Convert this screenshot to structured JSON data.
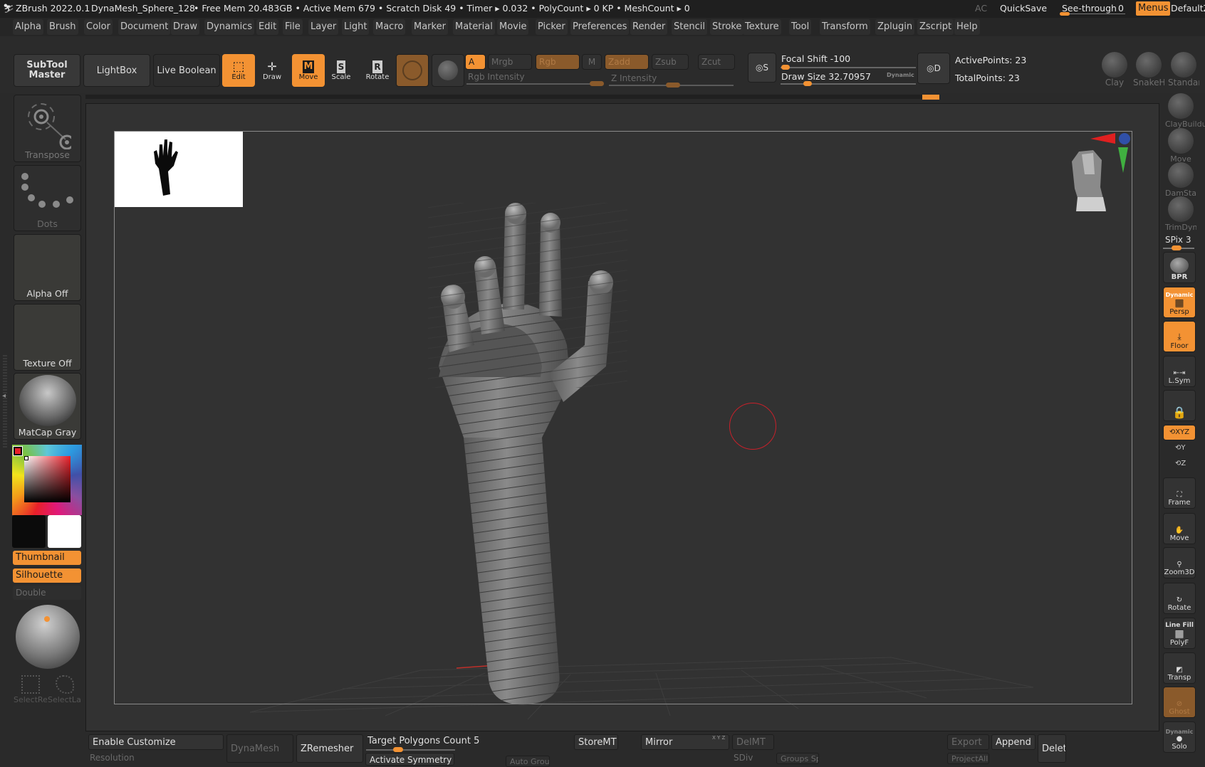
{
  "titlebar": {
    "app": "ZBrush 2022.0.1",
    "document": "DynaMesh_Sphere_128",
    "stats": "• Free Mem 20.483GB • Active Mem 679 • Scratch Disk 49 •  Timer ▸ 0.032 • PolyCount ▸ 0 KP  • MeshCount ▸ 0",
    "ac": "AC",
    "quicksave": "QuickSave",
    "see_through_label": "See-through",
    "see_through_value": "0",
    "menus": "Menus",
    "default_script": "DefaultZScript"
  },
  "menubar": [
    "Alpha",
    "Brush",
    "Color",
    "Document",
    "Draw",
    "Dynamics",
    "Edit",
    "File",
    "Layer",
    "Light",
    "Macro",
    "Marker",
    "Material",
    "Movie",
    "Picker",
    "Preferences",
    "Render",
    "Stencil",
    "Stroke",
    "Texture",
    "Tool",
    "Transform",
    "Zplugin",
    "Zscript",
    "Help"
  ],
  "shelf": {
    "subtool_master": "SubTool Master",
    "lightbox": "LightBox",
    "live_boolean": "Live Boolean",
    "edit": "Edit",
    "draw": "Draw",
    "move": "Move",
    "scale": "Scale",
    "rotate": "Rotate",
    "a": "A",
    "mrgb": "Mrgb",
    "rgb": "Rgb",
    "m": "M",
    "zadd": "Zadd",
    "zsub": "Zsub",
    "zcut": "Zcut",
    "rgb_intensity": "Rgb Intensity",
    "z_intensity": "Z Intensity",
    "focal_shift": "Focal Shift -100",
    "draw_size": "Draw Size 32.70957",
    "dynamic": "Dynamic",
    "active_points": "ActivePoints: 23",
    "total_points": "TotalPoints: 23",
    "s_label": "S",
    "d_label": "D"
  },
  "brushes": [
    "Clay",
    "SnakeHook",
    "Standard",
    "ClayBuildup",
    "Move",
    "DamStandard",
    "TrimDynamic"
  ],
  "leftbar": {
    "transpose": "Transpose",
    "dots": "Dots",
    "alpha": "Alpha Off",
    "texture": "Texture Off",
    "material": "MatCap Gray",
    "thumbnail": "Thumbnail",
    "silhouette": "Silhouette",
    "double": "Double",
    "select_rect": "SelectRect",
    "select_lasso": "SelectLasso"
  },
  "colors": {
    "accent": "#f39233",
    "primary_color": "#e8202a",
    "secondary_black": "#0b0b0b",
    "secondary_white": "#ffffff"
  },
  "rightbar": {
    "spix": "SPix 3",
    "bpr": "BPR",
    "persp": "Persp",
    "persp_dynamic": "Dynamic",
    "floor": "Floor",
    "lsym": "L.Sym",
    "xyz": "XYZ",
    "y": "Y",
    "z": "Z",
    "frame": "Frame",
    "move": "Move",
    "zoom3d": "Zoom3D",
    "rotate": "Rotate",
    "linefill": "Line Fill",
    "polyf": "PolyF",
    "transp": "Transp",
    "ghost": "Ghost",
    "solo_dynamic": "Dynamic",
    "solo": "Solo"
  },
  "bottom": {
    "enable_customize": "Enable Customize",
    "resolution": "Resolution",
    "dynamesh": "DynaMesh",
    "zremesher": "ZRemesher",
    "target_polygons": "Target Polygons Count 5",
    "activate_symmetry": "Activate Symmetry",
    "auto_groups": "Auto Groups",
    "storemt": "StoreMT",
    "mirror": "Mirror",
    "mirror_axes": "X Y Z",
    "delmt": "DelMT",
    "sdiv": "SDiv",
    "groups_split": "Groups Split",
    "export": "Export",
    "projectall": "ProjectAll",
    "append": "Append",
    "delete": "Delete"
  }
}
